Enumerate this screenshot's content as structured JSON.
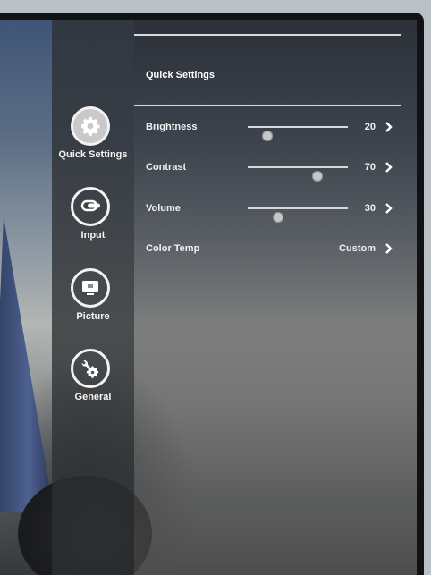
{
  "sidebar": {
    "items": [
      {
        "label": "Quick Settings",
        "icon": "gear-icon",
        "active": true
      },
      {
        "label": "Input",
        "icon": "input-connector-icon",
        "active": false
      },
      {
        "label": "Picture",
        "icon": "display-icon",
        "active": false
      },
      {
        "label": "General",
        "icon": "tools-icon",
        "active": false
      }
    ]
  },
  "main": {
    "section_title": "Quick Settings",
    "rows": [
      {
        "label": "Brightness",
        "value": "20",
        "level": 20,
        "type": "slider"
      },
      {
        "label": "Contrast",
        "value": "70",
        "level": 70,
        "type": "slider"
      },
      {
        "label": "Volume",
        "value": "30",
        "level": 30,
        "type": "slider"
      },
      {
        "label": "Color Temp",
        "value": "Custom",
        "type": "option"
      }
    ]
  },
  "colors": {
    "panel_text": "#f0f0f0",
    "slider_track": "#d8d8d8",
    "slider_thumb": "#c7c7c7"
  }
}
